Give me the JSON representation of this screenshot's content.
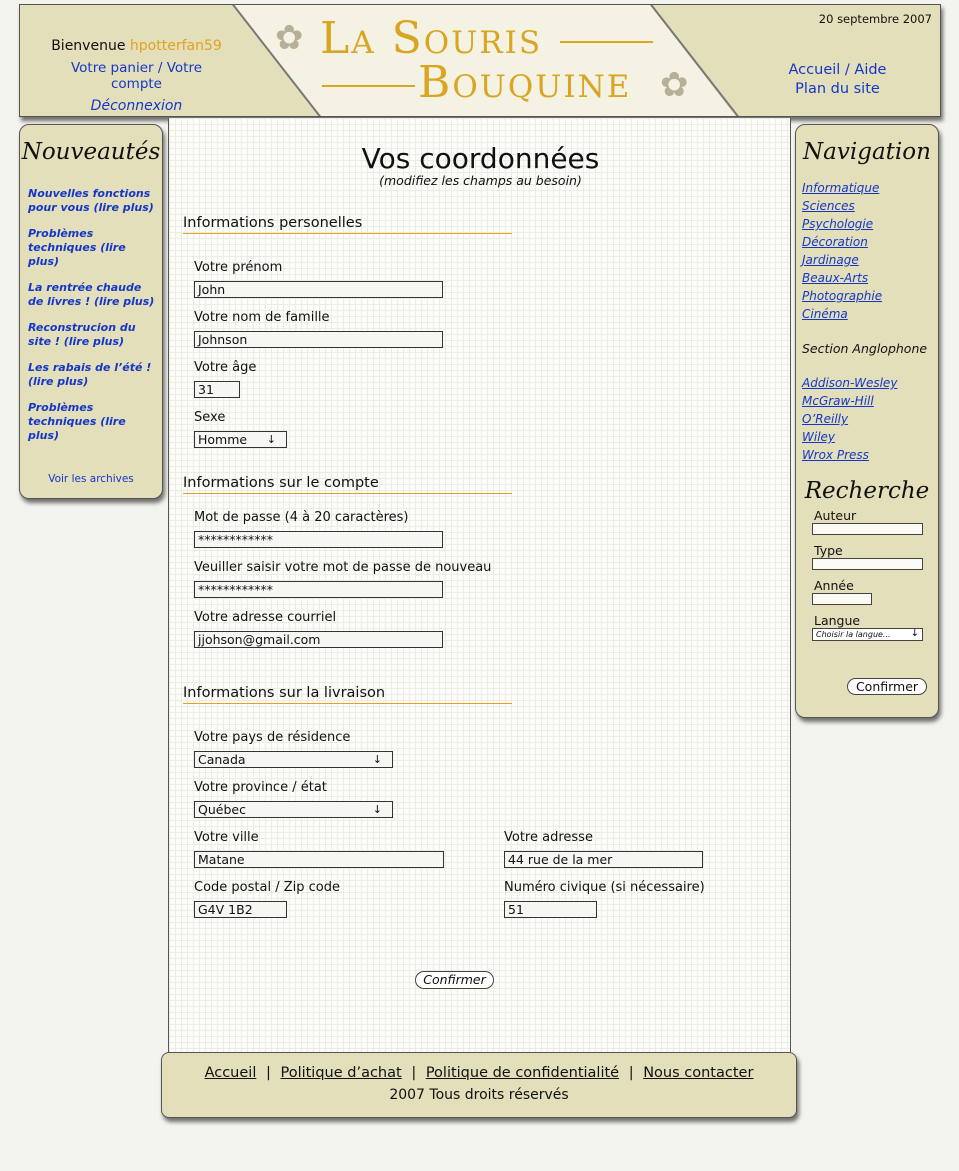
{
  "header": {
    "welcome_prefix": "Bienvenue",
    "username": "hpotterfan59",
    "cart_link": "Votre panier",
    "link_sep": "/",
    "account_link": "Votre compte",
    "logout_link": "Déconnexion",
    "logo_line1": "La Souris",
    "logo_line2": "Bouquine",
    "date": "20 septembre 2007",
    "nav_home": "Accueil",
    "nav_help": "Aide",
    "nav_sitemap": "Plan du site"
  },
  "left_sidebar": {
    "title": "Nouveautés",
    "news": [
      "Nouvelles fonctions pour vous (lire plus)",
      "Problèmes techniques (lire plus)",
      "La rentrée chaude de livres ! (lire plus)",
      "Reconstrucion du site ! (lire plus)",
      "Les rabais de l’été ! (lire plus)",
      "Problèmes techniques (lire plus)"
    ],
    "archives_link": "Voir les archives"
  },
  "right_sidebar": {
    "title": "Navigation",
    "categories": [
      "Informatique",
      "Sciences",
      "Psychologie",
      "Décoration",
      "Jardinage",
      "Beaux-Arts",
      "Photographie",
      "Cinéma"
    ],
    "anglophone_title": "Section Anglophone",
    "publishers": [
      "Addison-Wesley",
      "McGraw-Hill",
      "O’Reilly",
      "Wiley",
      "Wrox Press"
    ],
    "search": {
      "title": "Recherche",
      "author_label": "Auteur",
      "type_label": "Type",
      "year_label": "Année",
      "language_label": "Langue",
      "language_placeholder": "Choisir la langue...",
      "submit": "Confirmer"
    }
  },
  "main": {
    "title": "Vos coordonnées",
    "subtitle": "(modifiez les champs au besoin)",
    "personal": {
      "heading": "Informations personelles",
      "first_name_label": "Votre prénom",
      "first_name": "John",
      "last_name_label": "Votre nom de famille",
      "last_name": "Johnson",
      "age_label": "Votre âge",
      "age": "31",
      "sex_label": "Sexe",
      "sex": "Homme"
    },
    "account": {
      "heading": "Informations sur le compte",
      "password_label": "Mot de passe (4 à 20 caractères)",
      "password": "************",
      "password_confirm_label": "Veuiller saisir votre mot de passe de nouveau",
      "password_confirm": "************",
      "email_label": "Votre adresse courriel",
      "email": "jjohson@gmail.com"
    },
    "delivery": {
      "heading": "Informations sur la livraison",
      "country_label": "Votre pays de résidence",
      "country": "Canada",
      "province_label": "Votre province / état",
      "province": "Québec",
      "city_label": "Votre ville",
      "city": "Matane",
      "address_label": "Votre adresse",
      "address": "44 rue de la mer",
      "postal_label": "Code postal / Zip code",
      "postal": "G4V 1B2",
      "civic_label": "Numéro civique (si nécessaire)",
      "civic": "51"
    },
    "confirm_button": "Confirmer"
  },
  "footer": {
    "links": [
      "Accueil",
      "Politique d’achat",
      "Politique de confidentialité",
      "Nous contacter"
    ],
    "separator": "|",
    "copyright": "2007 Tous droits réservés"
  },
  "colors": {
    "panel_bg": "#e2dfba",
    "link_blue": "#1537c9",
    "accent_gold": "#d9a522",
    "username_orange": "#e3a21f"
  },
  "icons": {
    "logo_flower": "flower-icon",
    "dropdown": "down-arrow-icon"
  }
}
